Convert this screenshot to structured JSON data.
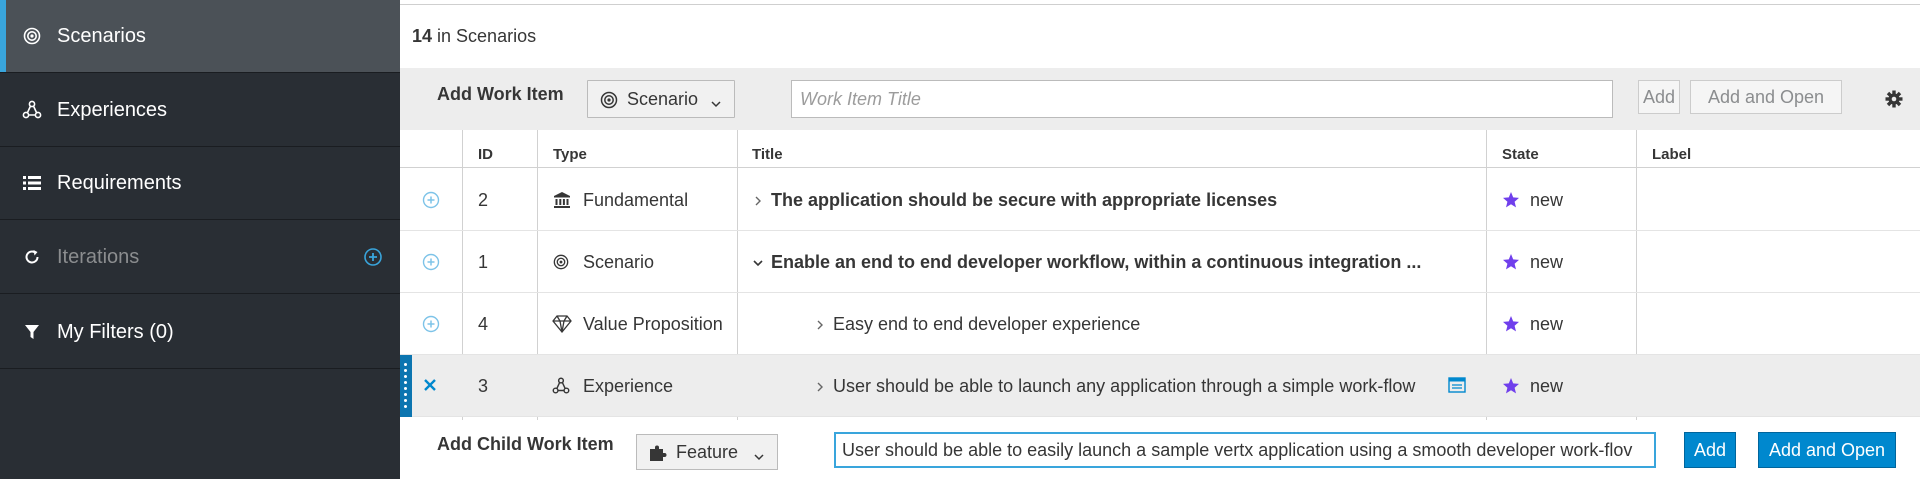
{
  "sidebar": {
    "items": [
      {
        "label": "Scenarios",
        "icon": "target-icon",
        "active": true
      },
      {
        "label": "Experiences",
        "icon": "hierarchy-icon"
      },
      {
        "label": "Requirements",
        "icon": "list-icon"
      },
      {
        "label": "Iterations",
        "icon": "refresh-icon",
        "dimmed": true,
        "has_add": true
      },
      {
        "label": "My Filters (0)",
        "icon": "filter-icon"
      }
    ]
  },
  "summary": {
    "count": "14",
    "suffix": " in Scenarios"
  },
  "add_bar": {
    "label": "Add Work Item",
    "type_value": "Scenario",
    "title_placeholder": "Work Item Title",
    "add_label": "Add",
    "add_open_label": "Add and Open"
  },
  "table": {
    "headers": {
      "id": "ID",
      "type": "Type",
      "title": "Title",
      "state": "State",
      "label": "Label"
    },
    "rows": [
      {
        "id": "2",
        "type": "Fundamental",
        "type_icon": "bank-icon",
        "title": "The application should be secure with appropriate licenses",
        "state": "new"
      },
      {
        "id": "1",
        "type": "Scenario",
        "type_icon": "target-icon",
        "title": "Enable an end to end developer workflow, within a continuous integration ...",
        "state": "new"
      },
      {
        "id": "4",
        "type": "Value Proposition",
        "type_icon": "diamond-icon",
        "title": "Easy end to end developer experience",
        "state": "new"
      },
      {
        "id": "3",
        "type": "Experience",
        "type_icon": "hierarchy-icon",
        "title": "User should be able to launch any application through a simple work-flow",
        "state": "new"
      }
    ]
  },
  "child_bar": {
    "label": "Add Child Work Item",
    "type_value": "Feature",
    "input_value": "User should be able to easily launch a sample vertx application using a smooth developer work-flov",
    "add_label": "Add",
    "add_open_label": "Add and Open"
  },
  "colors": {
    "sidebar_bg": "#292e34",
    "accent": "#39a5dc",
    "primary_button": "#0088ce",
    "state_star": "#703fec"
  }
}
